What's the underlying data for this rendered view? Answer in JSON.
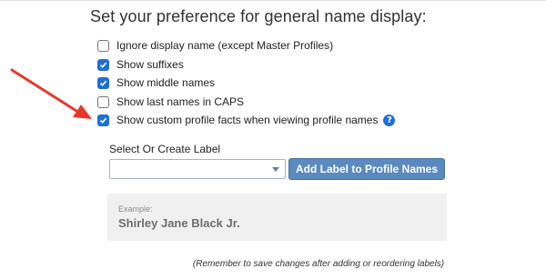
{
  "heading": "Set your preference for general name display:",
  "options": [
    {
      "label": "Ignore display name (except Master Profiles)",
      "checked": false
    },
    {
      "label": "Show suffixes",
      "checked": true
    },
    {
      "label": "Show middle names",
      "checked": true
    },
    {
      "label": "Show last names in CAPS",
      "checked": false
    },
    {
      "label": "Show custom profile facts when viewing profile names",
      "checked": true
    }
  ],
  "help_icon": {
    "glyph": "?",
    "icon": "question-circle-icon"
  },
  "label_select": {
    "caption": "Select Or Create Label",
    "value": ""
  },
  "add_button": "Add Label to Profile Names",
  "example": {
    "caption": "Example:",
    "name": "Shirley Jane Black Jr."
  },
  "note": "(Remember to save changes after adding or reordering labels)",
  "colors": {
    "accent": "#1f6fd6",
    "button": "#5b8ac0",
    "arrow": "#e8382b",
    "example_bg": "#f0f0f0"
  }
}
